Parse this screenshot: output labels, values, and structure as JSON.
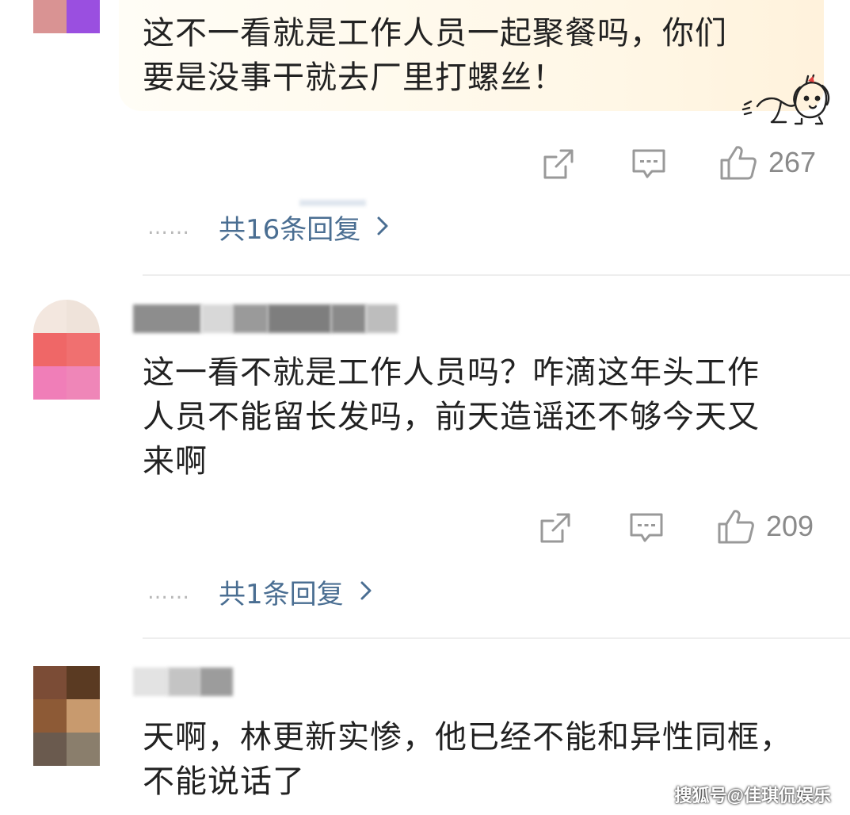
{
  "comments": [
    {
      "text_line1": "这不一看就是工作人员一起聚餐吗，你们",
      "text_line2": "要是没事干就去厂里打螺丝！",
      "likes": "267",
      "replies": "共16条回复",
      "dots": "……",
      "sticker": "dog-sticker"
    },
    {
      "text_line1": "这一看不就是工作人员吗？咋滴这年头工作",
      "text_line2": "人员不能留长发吗，前天造谣还不够今天又",
      "text_line3": "来啊",
      "likes": "209",
      "replies": "共1条回复",
      "dots": "……"
    },
    {
      "text_line1": "天啊，林更新实惨，他已经不能和异性同框，",
      "text_line2": "不能说话了"
    }
  ],
  "icons": {
    "share": "share-icon",
    "comment": "comment-icon",
    "like": "thumbs-up-icon",
    "chevron": "chevron-right-icon"
  },
  "colors": {
    "reply_link": "#4a6e92",
    "icon_gray": "#999999",
    "bubble": "#fff7e6"
  },
  "watermark": "搜狐号@佳琪侃娱乐"
}
